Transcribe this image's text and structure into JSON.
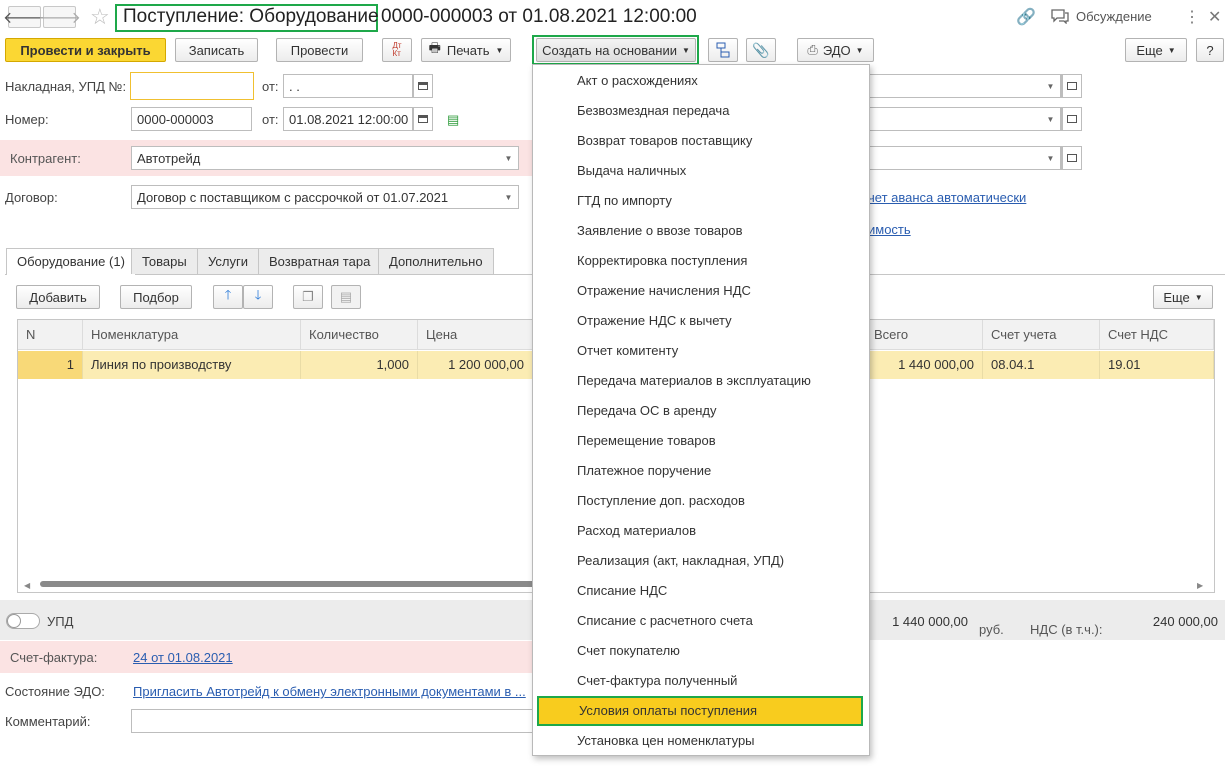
{
  "title": {
    "doc_type": "Поступление: Оборудование",
    "doc_number": "0000-000003 от 01.08.2021 12:00:00"
  },
  "topbar": {
    "discussion": "Обсуждение",
    "more": "⋮"
  },
  "toolbar": {
    "post_close": "Провести и закрыть",
    "save": "Записать",
    "post": "Провести",
    "dt_kt": "Дт Кт",
    "print": "Печать",
    "create_based": "Создать на основании",
    "edo": "ЭДО",
    "more": "Еще",
    "help": "?"
  },
  "form": {
    "invoice_label": "Накладная, УПД №:",
    "invoice_value": "",
    "from1": "от:",
    "date1": " .  .",
    "number_label": "Номер:",
    "number_value": "0000-000003",
    "from2": "от:",
    "date2": "01.08.2021 12:00:00",
    "counterparty_label": "Контрагент:",
    "counterparty_value": "Автотрейд",
    "contract_label": "Договор:",
    "contract_value": "Договор с поставщиком с рассрочкой от 01.07.2021",
    "advance_link": "чет аванса автоматически",
    "another_link": "имость"
  },
  "tabs": [
    "Оборудование (1)",
    "Товары",
    "Услуги",
    "Возвратная тара",
    "Дополнительно"
  ],
  "table_toolbar": {
    "add": "Добавить",
    "select": "Подбор",
    "more": "Еще"
  },
  "table": {
    "headers": [
      "N",
      "Номенклатура",
      "Количество",
      "Цена",
      "Всего",
      "Счет учета",
      "Счет НДС"
    ],
    "row": {
      "n": "1",
      "item": "Линия по производству",
      "qty": "1,000",
      "price": "1 200 000,00",
      "total": "1 440 000,00",
      "account": "08.04.1",
      "vat_account": "19.01"
    }
  },
  "footer": {
    "upd_label": "УПД",
    "total": "1 440 000,00",
    "currency": "руб.",
    "vat_label": "НДС (в т.ч.):",
    "vat_value": "240 000,00",
    "invoice_label": "Счет-фактура:",
    "invoice_link": "24 от 01.08.2021",
    "edo_label": "Состояние ЭДО:",
    "edo_link": "Пригласить Автотрейд к обмену электронными документами в ...",
    "comment_label": "Комментарий:"
  },
  "menu": {
    "items": [
      "Акт о расхождениях",
      "Безвозмездная передача",
      "Возврат товаров поставщику",
      "Выдача наличных",
      "ГТД по импорту",
      "Заявление о ввозе товаров",
      "Корректировка поступления",
      "Отражение начисления НДС",
      "Отражение НДС к вычету",
      "Отчет комитенту",
      "Передача материалов в эксплуатацию",
      "Передача ОС в аренду",
      "Перемещение товаров",
      "Платежное поручение",
      "Поступление доп. расходов",
      "Расход материалов",
      "Реализация (акт, накладная, УПД)",
      "Списание НДС",
      "Списание с расчетного счета",
      "Счет покупателю",
      "Счет-фактура полученный",
      "Условия оплаты поступления",
      "Установка цен номенклатуры"
    ],
    "selected_index": 21
  },
  "colors": {
    "accent_yellow": "#fbd733",
    "highlight_green": "#1ea84a",
    "row_selected": "#fbecb3",
    "link": "#2a5db0",
    "required_bg": "#fbe3e3"
  }
}
